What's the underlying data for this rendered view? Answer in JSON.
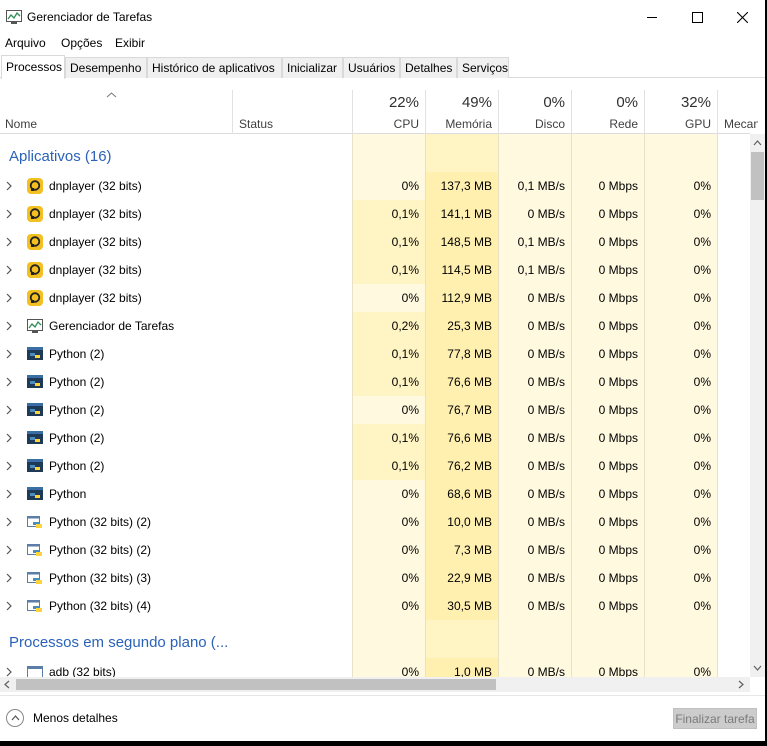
{
  "window": {
    "title": "Gerenciador de Tarefas"
  },
  "menu": [
    "Arquivo",
    "Opções",
    "Exibir"
  ],
  "tabs": [
    "Processos",
    "Desempenho",
    "Histórico de aplicativos",
    "Inicializar",
    "Usuários",
    "Detalhes",
    "Serviços"
  ],
  "active_tab": "Processos",
  "columns": {
    "name": "Nome",
    "status": "Status",
    "cpu": {
      "pct": "22%",
      "label": "CPU"
    },
    "memory": {
      "pct": "49%",
      "label": "Memória"
    },
    "disk": {
      "pct": "0%",
      "label": "Disco"
    },
    "network": {
      "pct": "0%",
      "label": "Rede"
    },
    "gpu": {
      "pct": "32%",
      "label": "GPU"
    },
    "gpu_engine": {
      "label": "Mecanis"
    }
  },
  "groups": {
    "apps_title": "Aplicativos (16)",
    "background_title": "Processos em segundo plano (..."
  },
  "apps": [
    {
      "name": "dnplayer (32 bits)",
      "icon": "dnplayer-icon",
      "cpu": "0%",
      "memory": "137,3 MB",
      "disk": "0,1 MB/s",
      "network": "0 Mbps",
      "gpu": "0%"
    },
    {
      "name": "dnplayer (32 bits)",
      "icon": "dnplayer-icon",
      "cpu": "0,1%",
      "memory": "141,1 MB",
      "disk": "0 MB/s",
      "network": "0 Mbps",
      "gpu": "0%"
    },
    {
      "name": "dnplayer (32 bits)",
      "icon": "dnplayer-icon",
      "cpu": "0,1%",
      "memory": "148,5 MB",
      "disk": "0,1 MB/s",
      "network": "0 Mbps",
      "gpu": "0%"
    },
    {
      "name": "dnplayer (32 bits)",
      "icon": "dnplayer-icon",
      "cpu": "0,1%",
      "memory": "114,5 MB",
      "disk": "0,1 MB/s",
      "network": "0 Mbps",
      "gpu": "0%"
    },
    {
      "name": "dnplayer (32 bits)",
      "icon": "dnplayer-icon",
      "cpu": "0%",
      "memory": "112,9 MB",
      "disk": "0 MB/s",
      "network": "0 Mbps",
      "gpu": "0%"
    },
    {
      "name": "Gerenciador de Tarefas",
      "icon": "task-manager-icon",
      "cpu": "0,2%",
      "memory": "25,3 MB",
      "disk": "0 MB/s",
      "network": "0 Mbps",
      "gpu": "0%"
    },
    {
      "name": "Python (2)",
      "icon": "python-icon",
      "cpu": "0,1%",
      "memory": "77,8 MB",
      "disk": "0 MB/s",
      "network": "0 Mbps",
      "gpu": "0%"
    },
    {
      "name": "Python (2)",
      "icon": "python-icon",
      "cpu": "0,1%",
      "memory": "76,6 MB",
      "disk": "0 MB/s",
      "network": "0 Mbps",
      "gpu": "0%"
    },
    {
      "name": "Python (2)",
      "icon": "python-icon",
      "cpu": "0%",
      "memory": "76,7 MB",
      "disk": "0 MB/s",
      "network": "0 Mbps",
      "gpu": "0%"
    },
    {
      "name": "Python (2)",
      "icon": "python-icon",
      "cpu": "0,1%",
      "memory": "76,6 MB",
      "disk": "0 MB/s",
      "network": "0 Mbps",
      "gpu": "0%"
    },
    {
      "name": "Python (2)",
      "icon": "python-icon",
      "cpu": "0,1%",
      "memory": "76,2 MB",
      "disk": "0 MB/s",
      "network": "0 Mbps",
      "gpu": "0%"
    },
    {
      "name": "Python",
      "icon": "python-icon",
      "cpu": "0%",
      "memory": "68,6 MB",
      "disk": "0 MB/s",
      "network": "0 Mbps",
      "gpu": "0%"
    },
    {
      "name": "Python (32 bits) (2)",
      "icon": "python-window-icon",
      "cpu": "0%",
      "memory": "10,0 MB",
      "disk": "0 MB/s",
      "network": "0 Mbps",
      "gpu": "0%"
    },
    {
      "name": "Python (32 bits) (2)",
      "icon": "python-window-icon",
      "cpu": "0%",
      "memory": "7,3 MB",
      "disk": "0 MB/s",
      "network": "0 Mbps",
      "gpu": "0%"
    },
    {
      "name": "Python (32 bits) (3)",
      "icon": "python-window-icon",
      "cpu": "0%",
      "memory": "22,9 MB",
      "disk": "0 MB/s",
      "network": "0 Mbps",
      "gpu": "0%"
    },
    {
      "name": "Python (32 bits) (4)",
      "icon": "python-window-icon",
      "cpu": "0%",
      "memory": "30,5 MB",
      "disk": "0 MB/s",
      "network": "0 Mbps",
      "gpu": "0%"
    }
  ],
  "background": [
    {
      "name": "adb (32 bits)",
      "icon": "app-window-icon",
      "cpu": "0%",
      "memory": "1,0 MB",
      "disk": "0 MB/s",
      "network": "0 Mbps",
      "gpu": "0%"
    }
  ],
  "footer": {
    "fewer_details": "Menos detalhes",
    "end_task": "Finalizar tarefa"
  },
  "colors": {
    "group_title": "#2a62b8",
    "cell_bg": "#fff9e0",
    "memory_bg": "#fff0b0",
    "highlight_bg": "#fff4c4"
  }
}
